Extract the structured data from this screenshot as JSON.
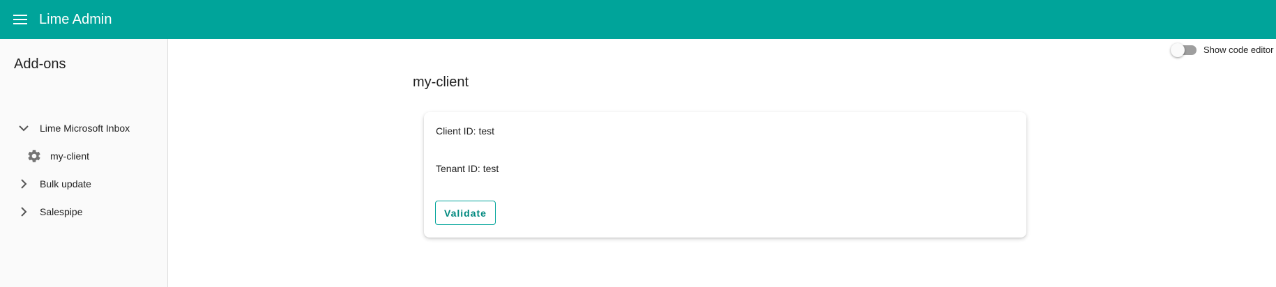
{
  "colors": {
    "primary": "#00a49a",
    "sidebar_bg": "#fafafa",
    "toggle_off": "#9e9e9e"
  },
  "header": {
    "menu_icon": "menu-icon",
    "title": "Lime Admin"
  },
  "sidebar": {
    "heading": "Add-ons",
    "items": [
      {
        "label": "Lime Microsoft Inbox",
        "icon": "chevron-down-icon",
        "expanded": true,
        "children": [
          {
            "label": "my-client",
            "icon": "gear-icon"
          }
        ]
      },
      {
        "label": "Bulk update",
        "icon": "chevron-right-icon",
        "expanded": false
      },
      {
        "label": "Salespipe",
        "icon": "chevron-right-icon",
        "expanded": false
      }
    ]
  },
  "main": {
    "title": "my-client",
    "code_editor_toggle": {
      "label": "Show code editor",
      "on": false
    },
    "card": {
      "client_id": "Client ID: test",
      "tenant_id": "Tenant ID: test",
      "validate_label": "Validate"
    }
  }
}
